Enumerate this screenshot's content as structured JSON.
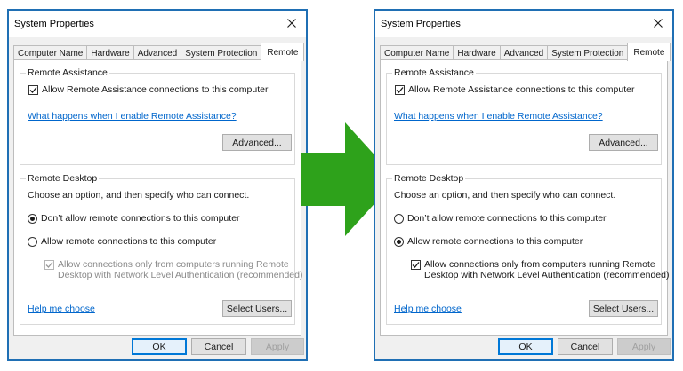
{
  "dialogs": [
    {
      "title": "System Properties",
      "tabs": [
        "Computer Name",
        "Hardware",
        "Advanced",
        "System Protection",
        "Remote"
      ],
      "active_tab": "Remote",
      "remote_assistance": {
        "group_title": "Remote Assistance",
        "allow_label": "Allow Remote Assistance connections to this computer",
        "allow_checked": true,
        "help_link": "What happens when I enable Remote Assistance?",
        "advanced_button": "Advanced..."
      },
      "remote_desktop": {
        "group_title": "Remote Desktop",
        "instructions": "Choose an option, and then specify who can connect.",
        "option_dont_allow": "Don’t allow remote connections to this computer",
        "option_allow": "Allow remote connections to this computer",
        "selected_option": "dont_allow",
        "nla_line1": "Allow connections only from computers running Remote",
        "nla_line2": "Desktop with Network Level Authentication (recommended)",
        "nla_checked": true,
        "nla_enabled": false,
        "help_link": "Help me choose",
        "select_users_button": "Select Users..."
      },
      "footer": {
        "ok": "OK",
        "cancel": "Cancel",
        "apply": "Apply"
      }
    },
    {
      "title": "System Properties",
      "tabs": [
        "Computer Name",
        "Hardware",
        "Advanced",
        "System Protection",
        "Remote"
      ],
      "active_tab": "Remote",
      "remote_assistance": {
        "group_title": "Remote Assistance",
        "allow_label": "Allow Remote Assistance connections to this computer",
        "allow_checked": true,
        "help_link": "What happens when I enable Remote Assistance?",
        "advanced_button": "Advanced..."
      },
      "remote_desktop": {
        "group_title": "Remote Desktop",
        "instructions": "Choose an option, and then specify who can connect.",
        "option_dont_allow": "Don’t allow remote connections to this computer",
        "option_allow": "Allow remote connections to this computer",
        "selected_option": "allow",
        "nla_line1": "Allow connections only from computers running Remote",
        "nla_line2": "Desktop with Network Level Authentication (recommended)",
        "nla_checked": true,
        "nla_enabled": true,
        "help_link": "Help me choose",
        "select_users_button": "Select Users..."
      },
      "footer": {
        "ok": "OK",
        "cancel": "Cancel",
        "apply": "Apply"
      }
    }
  ],
  "colors": {
    "frame_border": "#1f6fb4",
    "link": "#0066cc",
    "arrow": "#2ea21b",
    "dialog_bg": "#f0f0f0"
  },
  "icons": {
    "close": "close-icon",
    "check": "check-icon",
    "arrow": "right-arrow-icon"
  }
}
